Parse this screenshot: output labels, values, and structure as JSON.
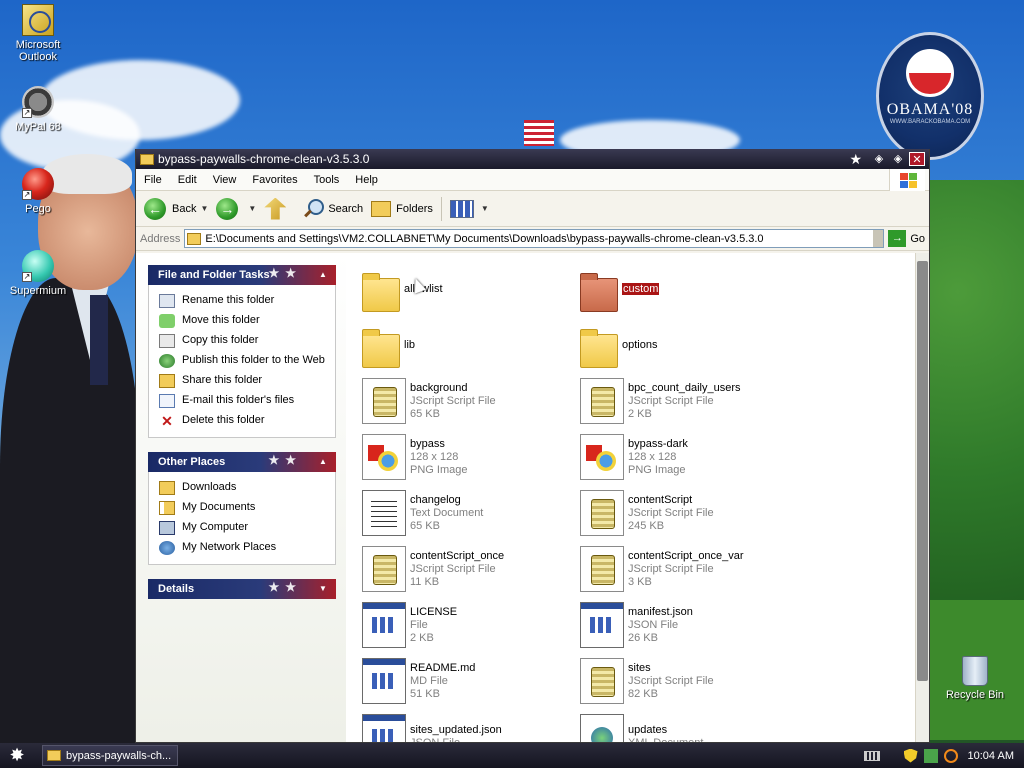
{
  "desktop": {
    "icons": [
      {
        "label": "Microsoft Outlook"
      },
      {
        "label": "MyPal 68"
      },
      {
        "label": "Pego"
      },
      {
        "label": "Supermium"
      }
    ],
    "recycle_bin": "Recycle Bin",
    "wallpaper_badge": {
      "title": "OBAMA'08",
      "sub": "WWW.BARACKOBAMA.COM"
    }
  },
  "window": {
    "title": "bypass-paywalls-chrome-clean-v3.5.3.0",
    "menu": [
      "File",
      "Edit",
      "View",
      "Favorites",
      "Tools",
      "Help"
    ],
    "toolbar": {
      "back": "Back",
      "search": "Search",
      "folders": "Folders"
    },
    "address": {
      "label": "Address",
      "value": "E:\\Documents and Settings\\VM2.COLLABNET\\My Documents\\Downloads\\bypass-paywalls-chrome-clean-v3.5.3.0",
      "go": "Go"
    },
    "tasks": {
      "title": "File and Folder Tasks",
      "items": [
        "Rename this folder",
        "Move this folder",
        "Copy this folder",
        "Publish this folder to the Web",
        "Share this folder",
        "E-mail this folder's files",
        "Delete this folder"
      ]
    },
    "other_places": {
      "title": "Other Places",
      "items": [
        "Downloads",
        "My Documents",
        "My Computer",
        "My Network Places"
      ]
    },
    "details": {
      "title": "Details"
    },
    "files": [
      {
        "name": "allowlist",
        "line2": "",
        "line3": "",
        "icon": "folder-icon"
      },
      {
        "name": "custom",
        "line2": "",
        "line3": "",
        "icon": "folder-red-icon"
      },
      {
        "name": "lib",
        "line2": "",
        "line3": "",
        "icon": "folder-icon"
      },
      {
        "name": "options",
        "line2": "",
        "line3": "",
        "icon": "folder-icon"
      },
      {
        "name": "background",
        "line2": "JScript Script File",
        "line3": "65 KB",
        "icon": "jscript-icon"
      },
      {
        "name": "bpc_count_daily_users",
        "line2": "JScript Script File",
        "line3": "2 KB",
        "icon": "jscript-icon"
      },
      {
        "name": "bypass",
        "line2": "128 x 128",
        "line3": "PNG Image",
        "icon": "png-icon"
      },
      {
        "name": "bypass-dark",
        "line2": "128 x 128",
        "line3": "PNG Image",
        "icon": "png-icon"
      },
      {
        "name": "changelog",
        "line2": "Text Document",
        "line3": "65 KB",
        "icon": "text-icon"
      },
      {
        "name": "contentScript",
        "line2": "JScript Script File",
        "line3": "245 KB",
        "icon": "jscript-icon"
      },
      {
        "name": "contentScript_once",
        "line2": "JScript Script File",
        "line3": "11 KB",
        "icon": "jscript-icon"
      },
      {
        "name": "contentScript_once_var",
        "line2": "JScript Script File",
        "line3": "3 KB",
        "icon": "jscript-icon"
      },
      {
        "name": "LICENSE",
        "line2": "File",
        "line3": "2 KB",
        "icon": "generic-file-icon"
      },
      {
        "name": "manifest.json",
        "line2": "JSON File",
        "line3": "26 KB",
        "icon": "generic-file-icon"
      },
      {
        "name": "README.md",
        "line2": "MD File",
        "line3": "51 KB",
        "icon": "generic-file-icon"
      },
      {
        "name": "sites",
        "line2": "JScript Script File",
        "line3": "82 KB",
        "icon": "jscript-icon"
      },
      {
        "name": "sites_updated.json",
        "line2": "JSON File",
        "line3": "",
        "icon": "generic-file-icon"
      },
      {
        "name": "updates",
        "line2": "XML Document",
        "line3": "",
        "icon": "xml-icon"
      }
    ],
    "selected_file": "custom"
  },
  "taskbar": {
    "task_button": "bypass-paywalls-ch...",
    "clock": "10:04 AM"
  },
  "colors": {
    "title_bar": "#1a1a2a",
    "selection": "#aa1515",
    "panel_header": "#1a2a66"
  }
}
